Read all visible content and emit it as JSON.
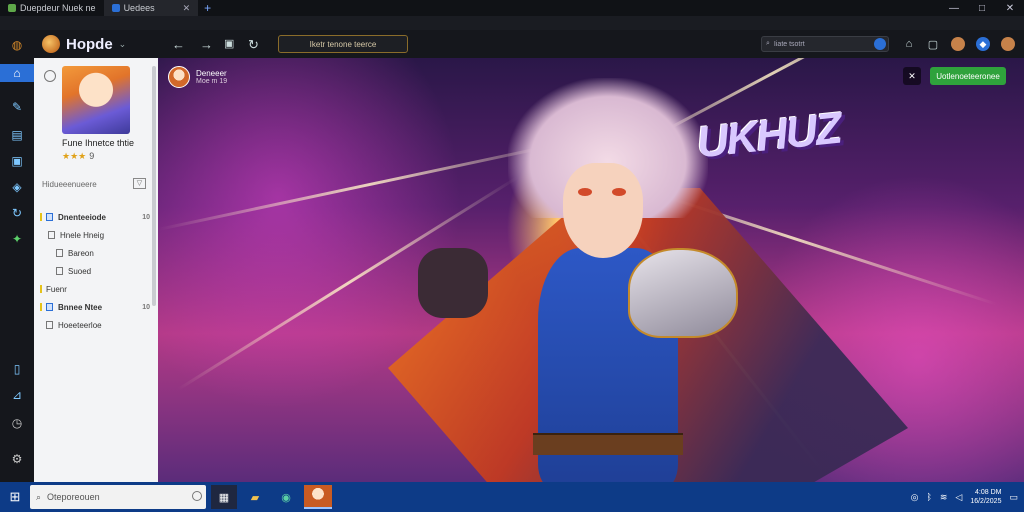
{
  "window": {
    "tabs": [
      {
        "label": "Duepdeur Nuek ne",
        "active": false
      },
      {
        "label": "Uedees",
        "active": true
      }
    ],
    "new_tab": "+",
    "controls": {
      "minimize": "—",
      "maximize": "□",
      "close": "✕"
    }
  },
  "app": {
    "title": "Hopde",
    "chevron": "⌄"
  },
  "address_bar": {
    "url": "Iketr tenone teerce",
    "search_placeholder": "Iiate tsotrt"
  },
  "side_panel": {
    "profile_name": "Fune Ihnetce thtie",
    "stars": "★★★",
    "rating_count": "9",
    "section_label": "Hidueeenueere",
    "tree": [
      {
        "label": "Dnenteeiode",
        "count": "10",
        "level": 0,
        "bold": true
      },
      {
        "label": "Hnele Hneig",
        "count": "",
        "level": 1,
        "bold": false
      },
      {
        "label": "Bareon",
        "count": "",
        "level": 2,
        "bold": false
      },
      {
        "label": "Suoed",
        "count": "",
        "level": 2,
        "bold": false
      },
      {
        "label": "Fuenr",
        "count": "",
        "level": 0,
        "bold": false
      },
      {
        "label": "Bnnee Ntee",
        "count": "10",
        "level": 0,
        "bold": true
      },
      {
        "label": "Hoeeteerloe",
        "count": "",
        "level": 0,
        "bold": false
      }
    ]
  },
  "hero": {
    "poster_name": "Deneeer",
    "poster_meta": "Moe m 19",
    "logo_text": "UKHUZ",
    "primary_button": "Uotlenoeteeronee",
    "secondary_button": "✕"
  },
  "taskbar": {
    "search_placeholder": "Oteporeouen",
    "clock_time": "4:08 DM",
    "clock_date": "16/2/2025"
  },
  "colors": {
    "accent": "#2b6fd6",
    "primary_button": "#2fa23c",
    "taskbar": "#0d3b87"
  }
}
